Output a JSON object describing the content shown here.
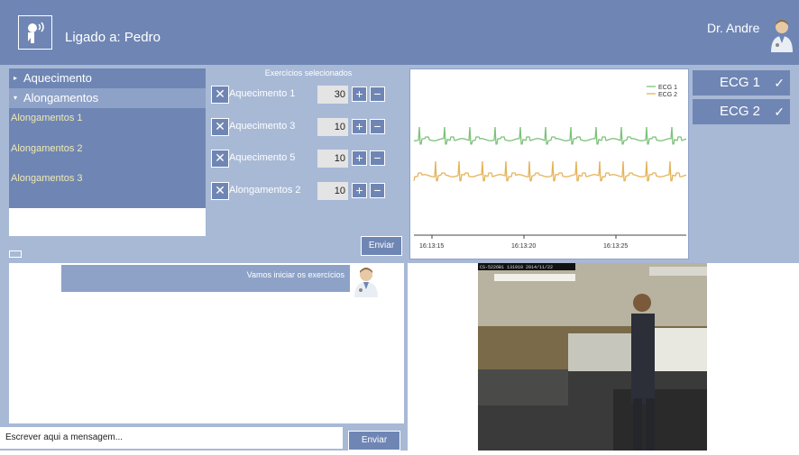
{
  "header": {
    "connected_label": "Ligado a: Pedro",
    "user_name": "Dr. Andre"
  },
  "exercise_tree": {
    "categories": [
      {
        "label": "Aquecimento",
        "expanded": false
      },
      {
        "label": "Alongamentos",
        "expanded": true
      }
    ],
    "items": [
      "Alongamentos 1",
      "Alongamentos 2",
      "Alongamentos 3"
    ]
  },
  "selected": {
    "title": "Exercícios selecionados",
    "rows": [
      {
        "label": "Aquecimento 1",
        "count": "30"
      },
      {
        "label": "Aquecimento 3",
        "count": "10"
      },
      {
        "label": "Aquecimento 5",
        "count": "10"
      },
      {
        "label": "Alongamentos 2",
        "count": "10"
      }
    ],
    "send_label": "Enviar",
    "remove_icon": "✕",
    "plus_icon": "+",
    "minus_icon": "−"
  },
  "chart_data": {
    "type": "line",
    "x_ticks": [
      "16:13:15",
      "16:13:20",
      "16:13:25"
    ],
    "series": [
      {
        "name": "ECG 1",
        "color": "#7cc27a"
      },
      {
        "name": "ECG 2",
        "color": "#e6b35a"
      }
    ],
    "legend": "top-right"
  },
  "channels": {
    "ecg1_label": "ECG 1",
    "ecg2_label": "ECG 2",
    "check_icon": "✓"
  },
  "chat": {
    "message": "Vamos iniciar os exercícios",
    "input_placeholder": "Escrever aqui a mensagem...",
    "send_label": "Enviar"
  },
  "video": {
    "overlay_text": "CS-5226B1 131910 2014/11/22"
  },
  "colors": {
    "accent": "#6f86b4",
    "panel": "#a8b9d6",
    "highlight": "#8ea2c8"
  }
}
